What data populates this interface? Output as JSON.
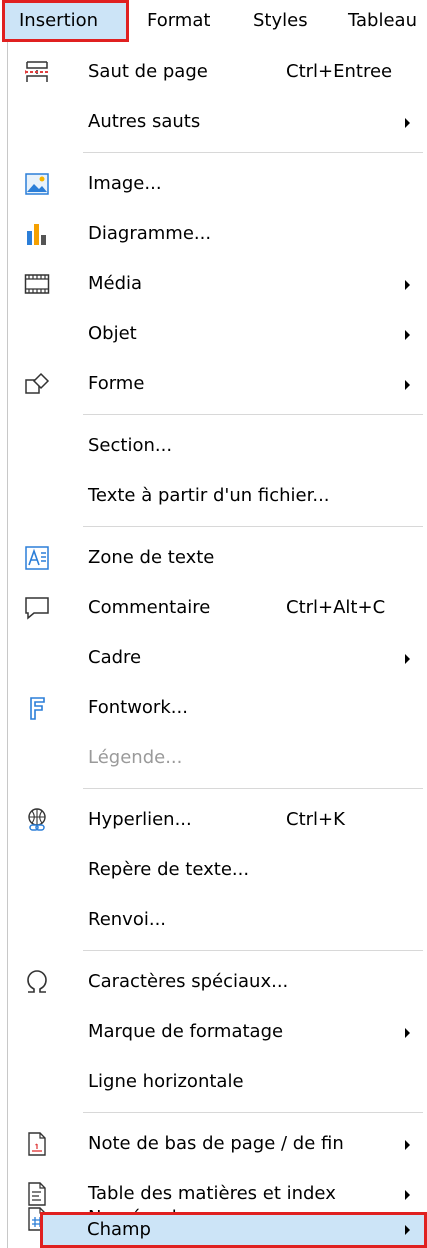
{
  "menubar": {
    "items": [
      {
        "label": "Insertion",
        "active": true
      },
      {
        "label": "Format",
        "active": false
      },
      {
        "label": "Styles",
        "active": false
      },
      {
        "label": "Tableau",
        "active": false
      }
    ]
  },
  "menu": {
    "items": [
      {
        "label": "Saut de page",
        "shortcut": "Ctrl+Entree",
        "icon": "page-break-icon"
      },
      {
        "label": "Autres sauts",
        "submenu": true
      },
      {
        "label": "Image...",
        "icon": "image-icon"
      },
      {
        "label": "Diagramme...",
        "icon": "chart-icon"
      },
      {
        "label": "Média",
        "submenu": true,
        "icon": "media-icon"
      },
      {
        "label": "Objet",
        "submenu": true
      },
      {
        "label": "Forme",
        "submenu": true,
        "icon": "shape-icon"
      },
      {
        "label": "Section..."
      },
      {
        "label": "Texte à partir d'un fichier..."
      },
      {
        "label": "Zone de texte",
        "icon": "text-box-icon"
      },
      {
        "label": "Commentaire",
        "shortcut": "Ctrl+Alt+C",
        "icon": "comment-icon"
      },
      {
        "label": "Cadre",
        "submenu": true
      },
      {
        "label": "Fontwork...",
        "icon": "fontwork-icon"
      },
      {
        "label": "Légende...",
        "disabled": true
      },
      {
        "label": "Hyperlien...",
        "shortcut": "Ctrl+K",
        "icon": "hyperlink-icon"
      },
      {
        "label": "Repère de texte..."
      },
      {
        "label": "Renvoi..."
      },
      {
        "label": "Caractères spéciaux...",
        "icon": "omega-icon"
      },
      {
        "label": "Marque de formatage",
        "submenu": true
      },
      {
        "label": "Ligne horizontale"
      },
      {
        "label": "Note de bas de page / de fin",
        "submenu": true,
        "icon": "footnote-icon"
      },
      {
        "label": "Table des matières et index",
        "submenu": true,
        "icon": "toc-icon"
      },
      {
        "label": "Numéro de page",
        "icon": "page-number-icon"
      },
      {
        "label": "Champ",
        "submenu": true,
        "highlighted": true
      }
    ]
  },
  "colors": {
    "highlight_bg": "#cce4f7",
    "highlight_border": "#e02020",
    "icon_blue": "#2b7ed8"
  }
}
